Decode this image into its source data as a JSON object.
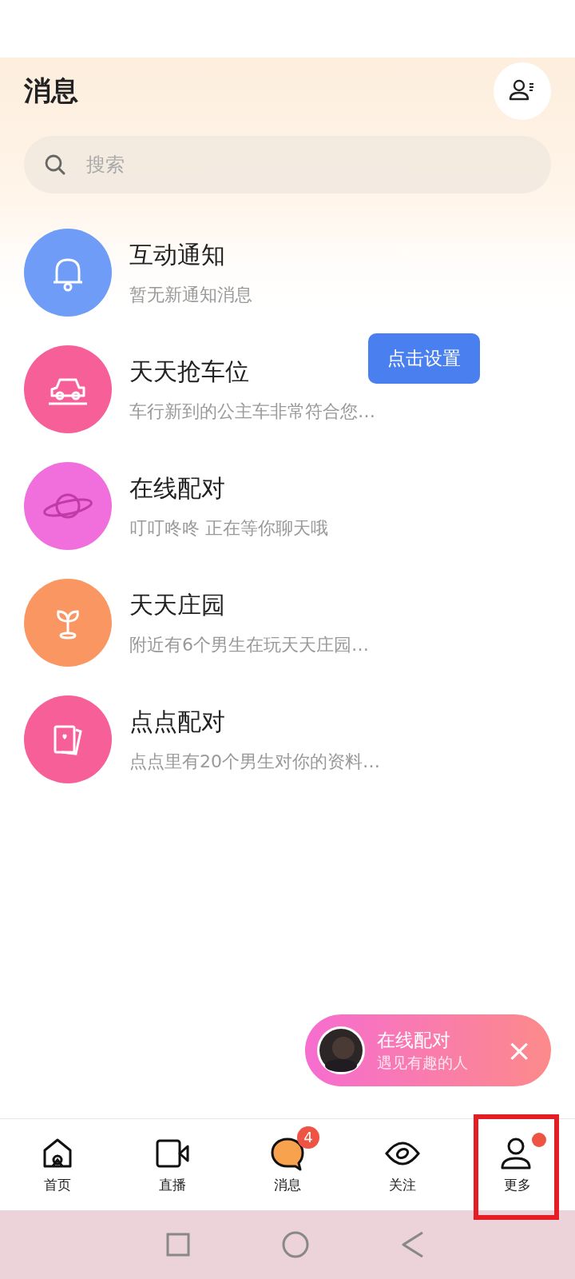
{
  "header": {
    "title": "消息"
  },
  "search": {
    "placeholder": "搜索"
  },
  "conversations": [
    {
      "kind": "bell",
      "color": "#6e9cf6",
      "name": "互动通知",
      "preview": "暂无新通知消息"
    },
    {
      "kind": "car",
      "color": "#f65f98",
      "name": "天天抢车位",
      "preview": "车行新到的公主车非常符合您…"
    },
    {
      "kind": "planet",
      "color": "#f06fdc",
      "name": "在线配对",
      "preview": "叮叮咚咚 正在等你聊天哦"
    },
    {
      "kind": "sprout",
      "color": "#fa9662",
      "name": "天天庄园",
      "preview": "附近有6个男生在玩天天庄园…"
    },
    {
      "kind": "cards",
      "color": "#f65f98",
      "name": "点点配对",
      "preview": "点点里有20个男生对你的资料…"
    }
  ],
  "tooltip": {
    "text": "点击设置"
  },
  "match_banner": {
    "title": "在线配对",
    "subtitle": "遇见有趣的人",
    "close": "×"
  },
  "tabs": [
    {
      "kind": "home",
      "label": "首页",
      "selected": false
    },
    {
      "kind": "video",
      "label": "直播",
      "selected": false
    },
    {
      "kind": "chat",
      "label": "消息",
      "selected": true,
      "badge": "4"
    },
    {
      "kind": "eye",
      "label": "关注",
      "selected": false
    },
    {
      "kind": "person",
      "label": "更多",
      "selected": false,
      "dot": true,
      "highlighted": true
    }
  ]
}
